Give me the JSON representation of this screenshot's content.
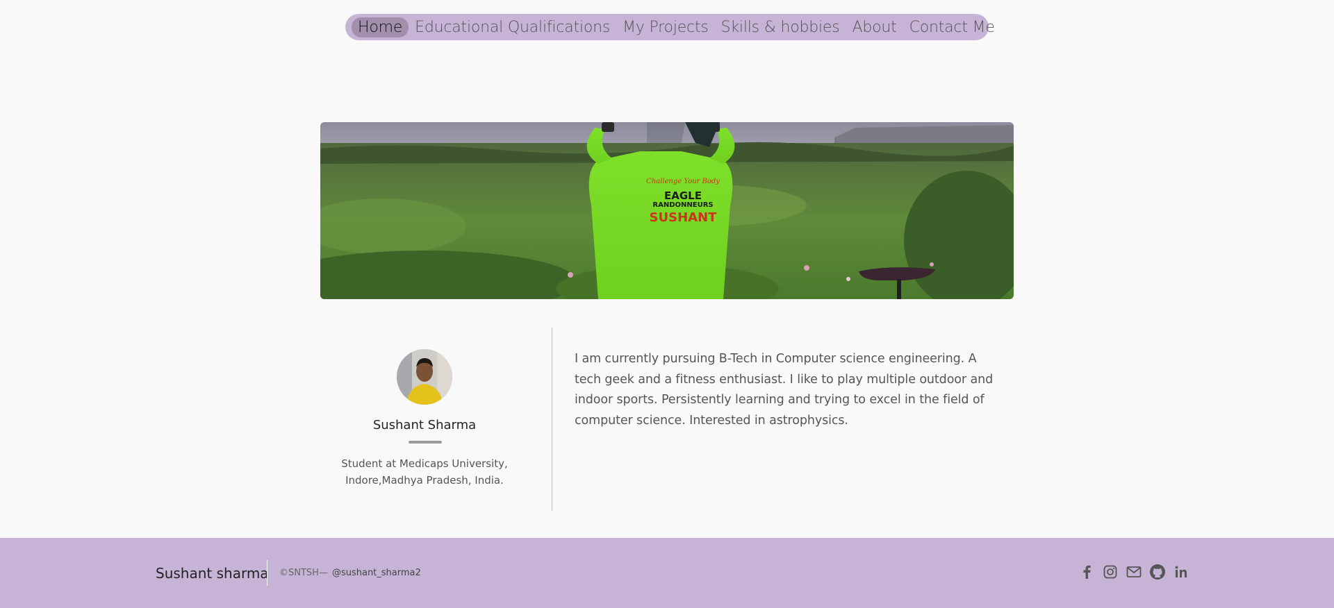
{
  "nav": {
    "items": [
      {
        "label": "Home",
        "active": true
      },
      {
        "label": "Educational Qualifications",
        "active": false
      },
      {
        "label": "My Projects",
        "active": false
      },
      {
        "label": "Skills & hobbies",
        "active": false
      },
      {
        "label": "About",
        "active": false
      },
      {
        "label": "Contact Me",
        "active": false
      }
    ]
  },
  "banner": {
    "shirt_tagline": "Challenge Your Body",
    "shirt_club_line1": "EAGLE",
    "shirt_club_line2": "RANDONNEURS",
    "shirt_name": "SUSHANT"
  },
  "profile": {
    "name": "Sushant Sharma",
    "subtitle_line1": "Student at Medicaps University,",
    "subtitle_line2": "Indore,Madhya Pradesh, India."
  },
  "bio": {
    "text": "I am currently pursuing B-Tech in Computer science engineering. A tech geek and a fitness enthusiast. I like to play multiple outdoor and indoor sports. Persistently learning and trying to excel in the field of computer science. Interested in astrophysics."
  },
  "footer": {
    "brand": "Sushant sharma",
    "copyright": "©SNTSH—",
    "handle": "@sushant_sharma2",
    "socials": [
      "facebook-icon",
      "instagram-icon",
      "mail-icon",
      "github-icon",
      "linkedin-icon"
    ]
  },
  "colors": {
    "accent": "#c6b3d6",
    "nav_active": "#a18fab",
    "background": "#f9f9f9"
  }
}
